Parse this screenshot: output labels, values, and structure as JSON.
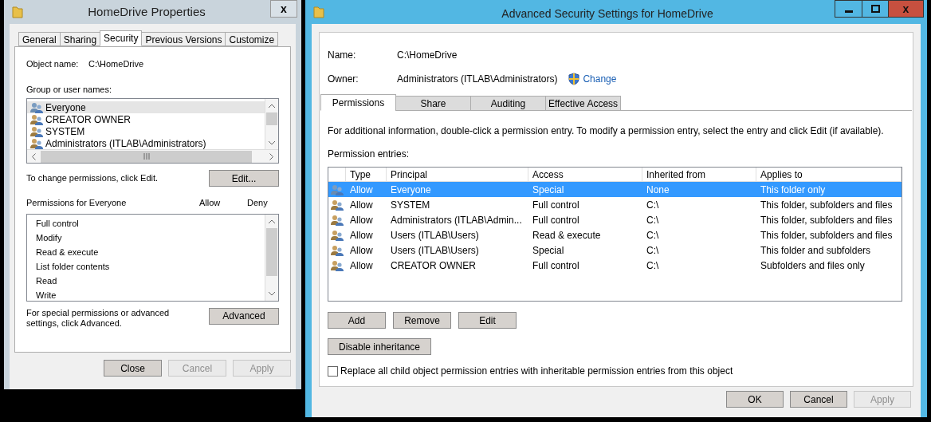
{
  "properties_window": {
    "title": "HomeDrive Properties",
    "close": "x",
    "tabs": [
      {
        "label": "General",
        "selected": false
      },
      {
        "label": "Sharing",
        "selected": false
      },
      {
        "label": "Security",
        "selected": true
      },
      {
        "label": "Previous Versions",
        "selected": false
      },
      {
        "label": "Customize",
        "selected": false
      }
    ],
    "object_name_label": "Object name:",
    "object_name": "C:\\HomeDrive",
    "group_label": "Group or user names:",
    "groups": [
      {
        "name": "Everyone",
        "selected": true
      },
      {
        "name": "CREATOR OWNER",
        "selected": false
      },
      {
        "name": "SYSTEM",
        "selected": false
      },
      {
        "name": "Administrators (ITLAB\\Administrators)",
        "selected": false
      }
    ],
    "change_hint": "To change permissions, click Edit.",
    "edit_button": "Edit...",
    "permissions_label": "Permissions for Everyone",
    "allow_label": "Allow",
    "deny_label": "Deny",
    "permissions": [
      "Full control",
      "Modify",
      "Read & execute",
      "List folder contents",
      "Read",
      "Write"
    ],
    "advanced_hint": "For special permissions or advanced settings, click Advanced.",
    "advanced_button": "Advanced",
    "buttons": [
      {
        "label": "Close",
        "disabled": false
      },
      {
        "label": "Cancel",
        "disabled": true
      },
      {
        "label": "Apply",
        "disabled": true
      }
    ]
  },
  "advanced_window": {
    "title": "Advanced Security Settings for HomeDrive",
    "close": "x",
    "name_label": "Name:",
    "name": "C:\\HomeDrive",
    "owner_label": "Owner:",
    "owner": "Administrators (ITLAB\\Administrators)",
    "change_link": "Change",
    "tabs": [
      {
        "label": "Permissions",
        "selected": true
      },
      {
        "label": "Share",
        "selected": false
      },
      {
        "label": "Auditing",
        "selected": false
      },
      {
        "label": "Effective Access",
        "selected": false
      }
    ],
    "info": "For additional information, double-click a permission entry. To modify a permission entry, select the entry and click Edit (if available).",
    "entries_label": "Permission entries:",
    "table": {
      "columns": [
        "Type",
        "Principal",
        "Access",
        "Inherited from",
        "Applies to"
      ],
      "rows": [
        {
          "cells": [
            "Allow",
            "Everyone",
            "Special",
            "None",
            "This folder only"
          ],
          "selected": true
        },
        {
          "cells": [
            "Allow",
            "SYSTEM",
            "Full control",
            "C:\\",
            "This folder, subfolders and files"
          ],
          "selected": false
        },
        {
          "cells": [
            "Allow",
            "Administrators (ITLAB\\Admin...",
            "Full control",
            "C:\\",
            "This folder, subfolders and files"
          ],
          "selected": false
        },
        {
          "cells": [
            "Allow",
            "Users (ITLAB\\Users)",
            "Read & execute",
            "C:\\",
            "This folder, subfolders and files"
          ],
          "selected": false
        },
        {
          "cells": [
            "Allow",
            "Users (ITLAB\\Users)",
            "Special",
            "C:\\",
            "This folder and subfolders"
          ],
          "selected": false
        },
        {
          "cells": [
            "Allow",
            "CREATOR OWNER",
            "Full control",
            "C:\\",
            "Subfolders and files only"
          ],
          "selected": false
        }
      ]
    },
    "entry_buttons": [
      "Add",
      "Remove",
      "Edit"
    ],
    "disable_inheritance_button": "Disable inheritance",
    "replace_checkbox": {
      "label": "Replace all child object permission entries with inheritable permission entries from this object",
      "checked": false
    },
    "buttons": [
      {
        "label": "OK",
        "disabled": false
      },
      {
        "label": "Cancel",
        "disabled": false
      },
      {
        "label": "Apply",
        "disabled": true
      }
    ]
  }
}
